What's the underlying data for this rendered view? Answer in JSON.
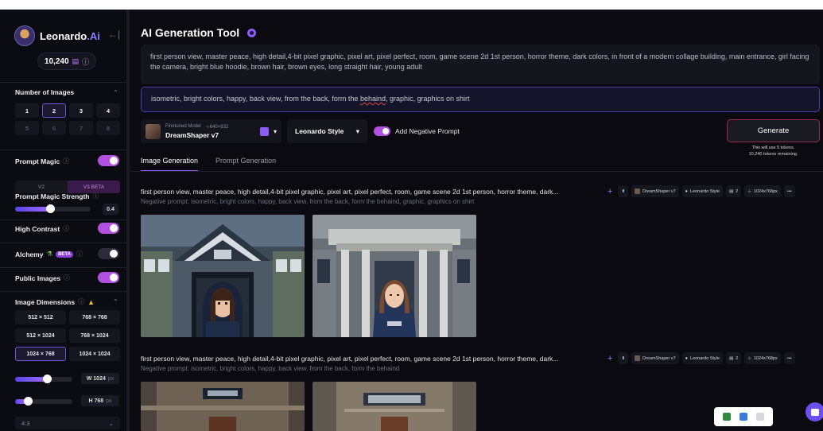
{
  "sidebar": {
    "brand": {
      "name": "Leonardo",
      "suffix": ".Ai"
    },
    "collapse_icon": "←|",
    "tokens": "10,240",
    "number_of_images": {
      "title": "Number of Images",
      "options": [
        "1",
        "2",
        "3",
        "4",
        "5",
        "6",
        "7",
        "8"
      ],
      "selected": "2"
    },
    "prompt_magic": {
      "title": "Prompt Magic",
      "enabled": true,
      "v2": "V2",
      "v3": "V3",
      "v3_badge": "BETA"
    },
    "prompt_magic_strength": {
      "title": "Prompt Magic Strength",
      "value": "0.4"
    },
    "high_contrast": {
      "title": "High Contrast",
      "enabled": true
    },
    "alchemy": {
      "title": "Alchemy",
      "badge": "BETA",
      "enabled": false
    },
    "public_images": {
      "title": "Public Images",
      "enabled": true
    },
    "image_dimensions": {
      "title": "Image Dimensions",
      "options": [
        "512 × 512",
        "768 × 768",
        "512 × 1024",
        "768 × 1024",
        "1024 × 768",
        "1024 × 1024"
      ],
      "selected": "1024 × 768",
      "width_label": "W",
      "width_value": "1024",
      "height_label": "H",
      "height_value": "768",
      "unit": "px",
      "width_fraction": 0.55,
      "height_fraction": 0.22
    },
    "aspect_ratio": "4:3"
  },
  "main": {
    "title": "AI Generation Tool",
    "prompt": "first person view, master peace, high detail,4-bit pixel graphic, pixel art, pixel perfect, room, game scene 2d 1st person, horror theme, dark colors, in front of a modern collage building, main entrance, girl facing the camera, bright blue hoodie, brown hair, brown eyes, long straight hair, young adult",
    "negative_prompt_pre": "isometric, bright colors, happy, back view, from the back, form the ",
    "negative_prompt_err": "behaind",
    "negative_prompt_post": ", graphic, graphics on shirt",
    "model": {
      "label": "Finetuned Model",
      "size": "640×832",
      "name": "DreamShaper v7"
    },
    "style": "Leonardo Style",
    "add_negative_prompt": "Add Negative Prompt",
    "generate_label": "Generate",
    "generate_note_1": "This will use 5 tokens.",
    "generate_note_2": "10,240 tokens remaining.",
    "tabs": [
      "Image Generation",
      "Prompt Generation"
    ],
    "generations": [
      {
        "prompt": "first person view, master peace, high detail,4-bit pixel graphic, pixel art, pixel perfect, room, game scene 2d 1st person, horror theme, dark...",
        "negative": "Negative prompt: isometric, bright colors, happy, back view, from the back, form the behaind, graphic, graphics on shirt",
        "model": "DreamShaper v7",
        "style": "Leonardo Style",
        "count": "2",
        "size": "1024x768px"
      },
      {
        "prompt": "first person view, master peace, high detail,4-bit pixel graphic, pixel art, pixel perfect, room, game scene 2d 1st person, horror theme, dark...",
        "negative": "Negative prompt: isometric, bright colors, happy, back view, from the back, form the behaind",
        "model": "DreamShaper v7",
        "style": "Leonardo Style",
        "count": "2",
        "size": "1024x768px"
      }
    ]
  },
  "colors": {
    "accent": "#8b5cf6",
    "toggle": "#b250e0",
    "generate_border": "#9a2a52"
  }
}
